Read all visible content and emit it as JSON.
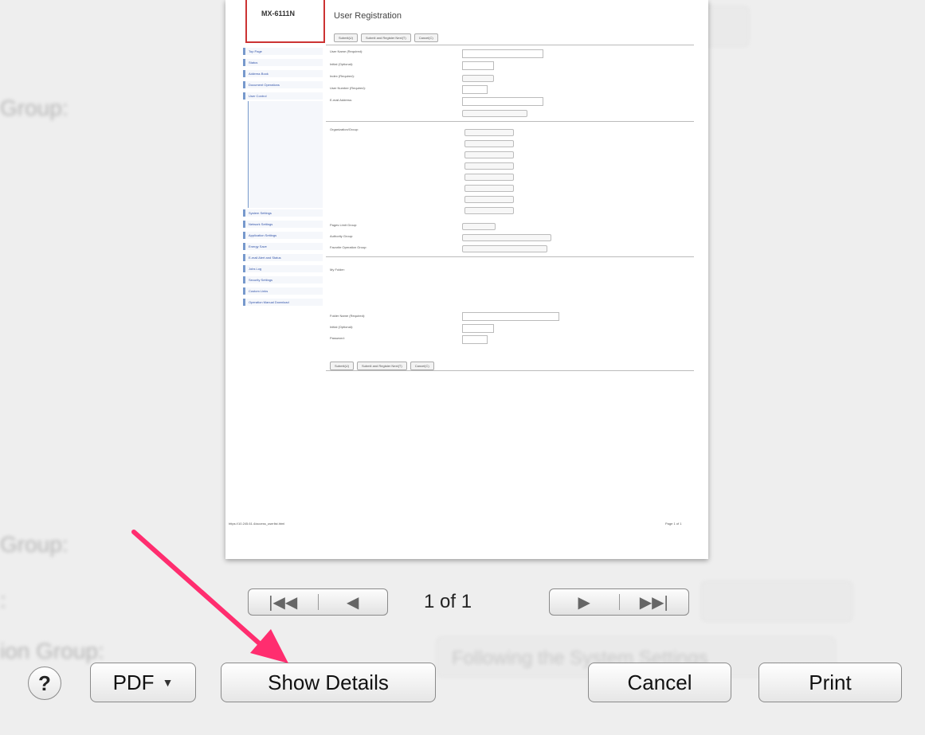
{
  "background": {
    "label_group_top": "Group:",
    "label_group_bottom": "Group:",
    "label_colon": ":",
    "label_operation_group": "ion Group:",
    "select_following": "Following the System Settings"
  },
  "preview": {
    "logo_text": "MX-6111N",
    "title": "User Registration",
    "buttons": [
      "Submit(U)",
      "Submit and Register Next(T)",
      "Cancel(C)"
    ],
    "nav_items": [
      "Top Page",
      "Status",
      "Address Book",
      "Document Operations",
      "User Control",
      "System Settings",
      "Network Settings",
      "Application Settings",
      "Energy Save",
      "E-mail Alert and Status",
      "Jobs Log",
      "Security Settings",
      "Custom Links",
      "Operation Manual Download"
    ],
    "fields": [
      "User Name (Required):",
      "Initial (Optional):",
      "Index (Required):",
      "User Number (Required):",
      "E-mail Address:",
      "Organization/Group:",
      "Pages Limit Group:",
      "Authority Group:",
      "Favorite Operation Group:",
      "My Folder:",
      "Folder Name (Required):",
      "Initial (Optional):",
      "Password:"
    ],
    "footer_url": "https://10.245.61.4/access_userlist.html",
    "footer_page": "Page 1 of 1"
  },
  "pager": {
    "first_icon": "first-page-icon",
    "prev_icon": "previous-page-icon",
    "next_icon": "next-page-icon",
    "last_icon": "last-page-icon",
    "count": "1 of 1"
  },
  "footer": {
    "help_label": "?",
    "pdf_label": "PDF",
    "show_details_label": "Show Details",
    "cancel_label": "Cancel",
    "print_label": "Print"
  },
  "colors": {
    "annotation_arrow": "#ff2d6f"
  }
}
